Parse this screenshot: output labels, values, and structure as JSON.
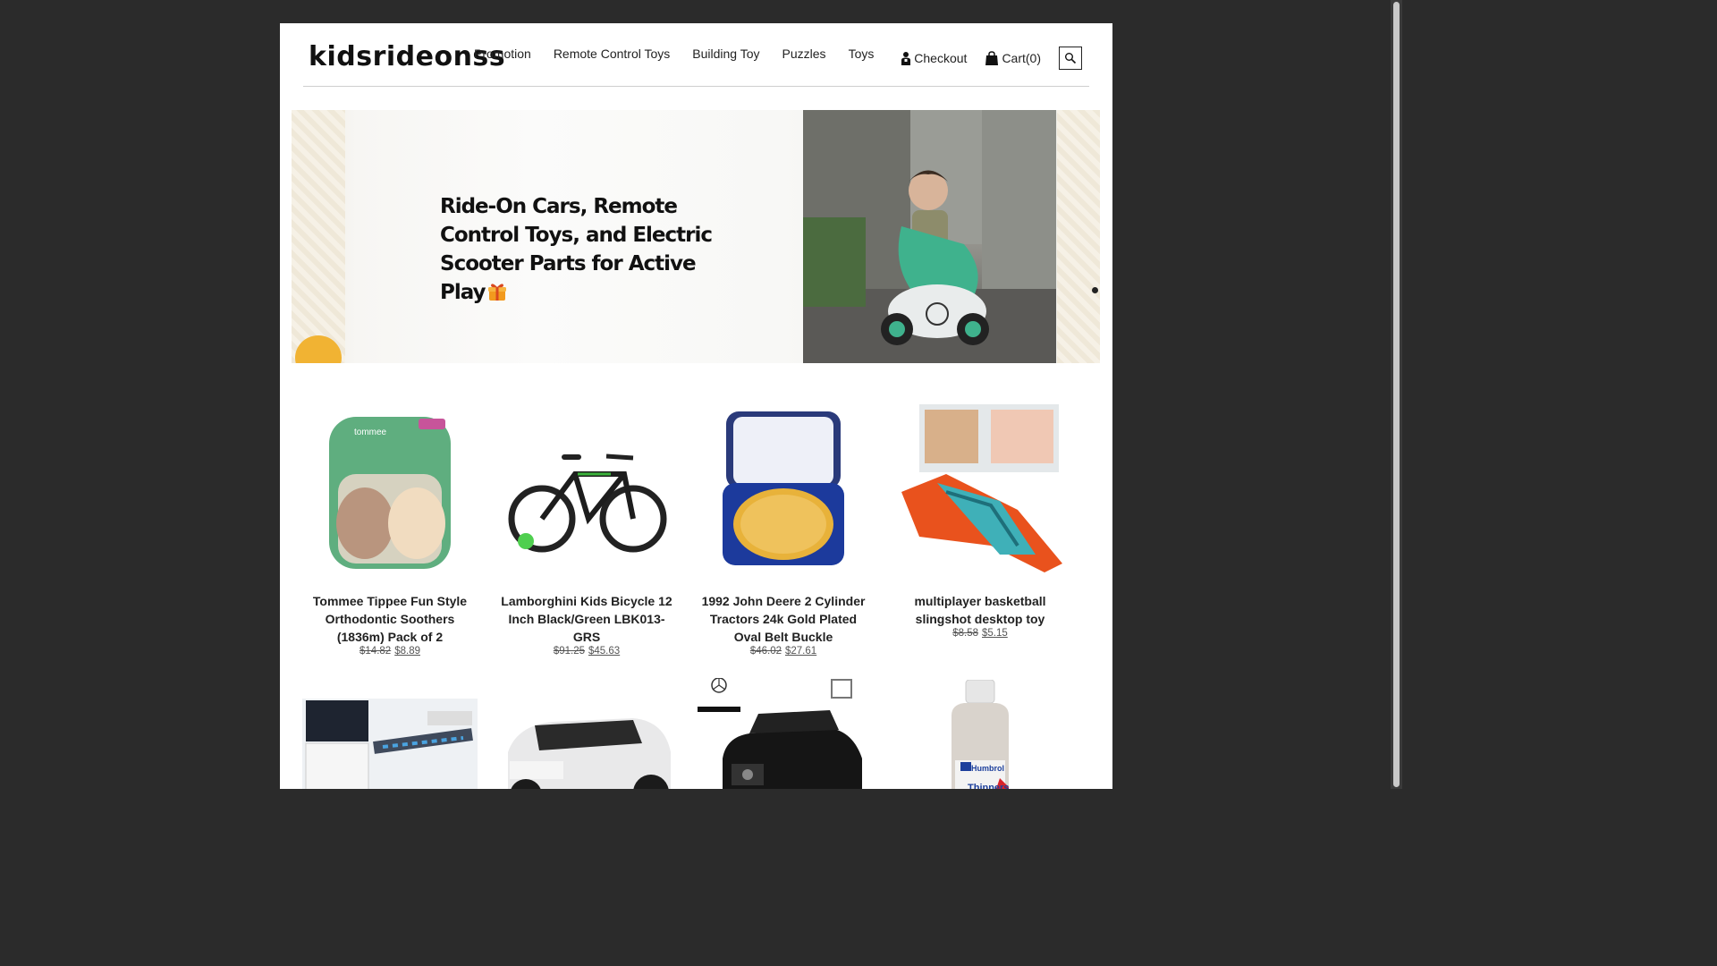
{
  "header": {
    "logo": "kidsrideonss",
    "nav": [
      "Promotion",
      "Remote Control Toys",
      "Building Toy",
      "Puzzles",
      "Toys"
    ],
    "checkout_label": "Checkout",
    "cart_label": "Cart(0)"
  },
  "banner": {
    "headline": "Ride-On Cars, Remote Control Toys, and Electric Scooter Parts for Active Play"
  },
  "products": [
    {
      "title": "Tommee Tippee Fun Style Orthodontic Soothers (1836m) Pack of 2",
      "old_price": "$14.82",
      "price": "$8.89"
    },
    {
      "title": "Lamborghini Kids Bicycle 12 Inch Black/Green LBK013-GRS",
      "old_price": "$91.25",
      "price": "$45.63"
    },
    {
      "title": "1992 John Deere 2 Cylinder Tractors 24k Gold Plated Oval Belt Buckle",
      "old_price": "$46.02",
      "price": "$27.61"
    },
    {
      "title": "multiplayer basketball slingshot desktop toy",
      "old_price": "$8.58",
      "price": "$5.15"
    }
  ],
  "colors": {
    "background": "#2b2b2b",
    "page": "#ffffff",
    "text": "#222222",
    "gold": "#e8b23a",
    "accent_green": "#3fb28d"
  },
  "icons": [
    "person-icon",
    "shopping-bag-icon",
    "search-icon",
    "gift-icon"
  ]
}
